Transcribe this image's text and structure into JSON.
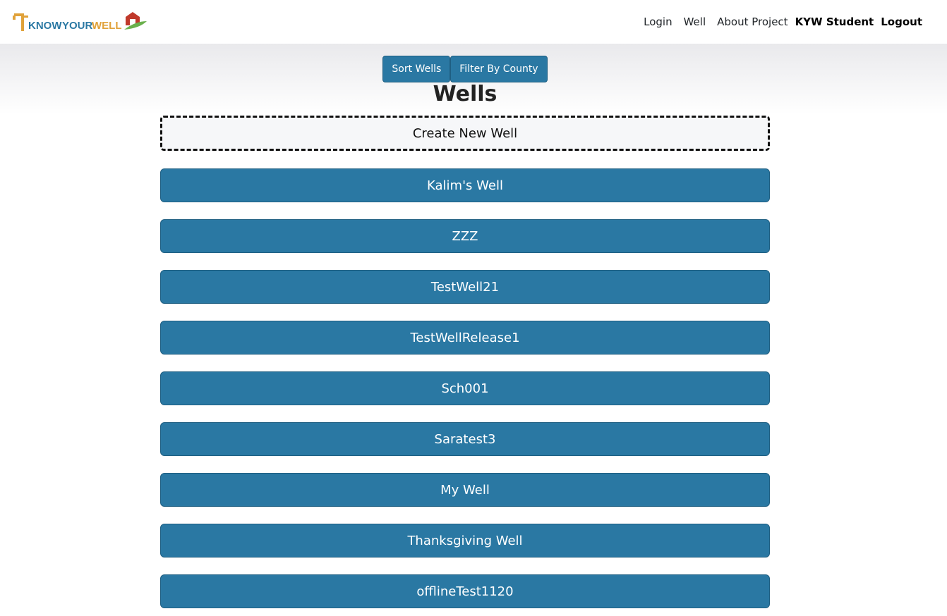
{
  "brand": {
    "logo_text_know": "KNOW",
    "logo_text_your": "YOUR",
    "logo_text_well": "WELL"
  },
  "nav": {
    "login": "Login",
    "well": "Well",
    "about": "About Project",
    "user": "KYW Student",
    "logout": "Logout"
  },
  "toolbar": {
    "sort_label": "Sort Wells",
    "filter_label": "Filter By County"
  },
  "page": {
    "title": "Wells",
    "create_label": "Create New Well"
  },
  "wells": [
    "Kalim's Well",
    "ZZZ",
    "TestWell21",
    "TestWellRelease1",
    "Sch001",
    "Saratest3",
    "My Well",
    "Thanksgiving Well",
    "offlineTest1120"
  ],
  "colors": {
    "primary": "#2a78a3",
    "logo_orange": "#e0a23a",
    "logo_blue": "#2a78a3",
    "logo_red": "#c0392b",
    "logo_green": "#6ab04c"
  }
}
